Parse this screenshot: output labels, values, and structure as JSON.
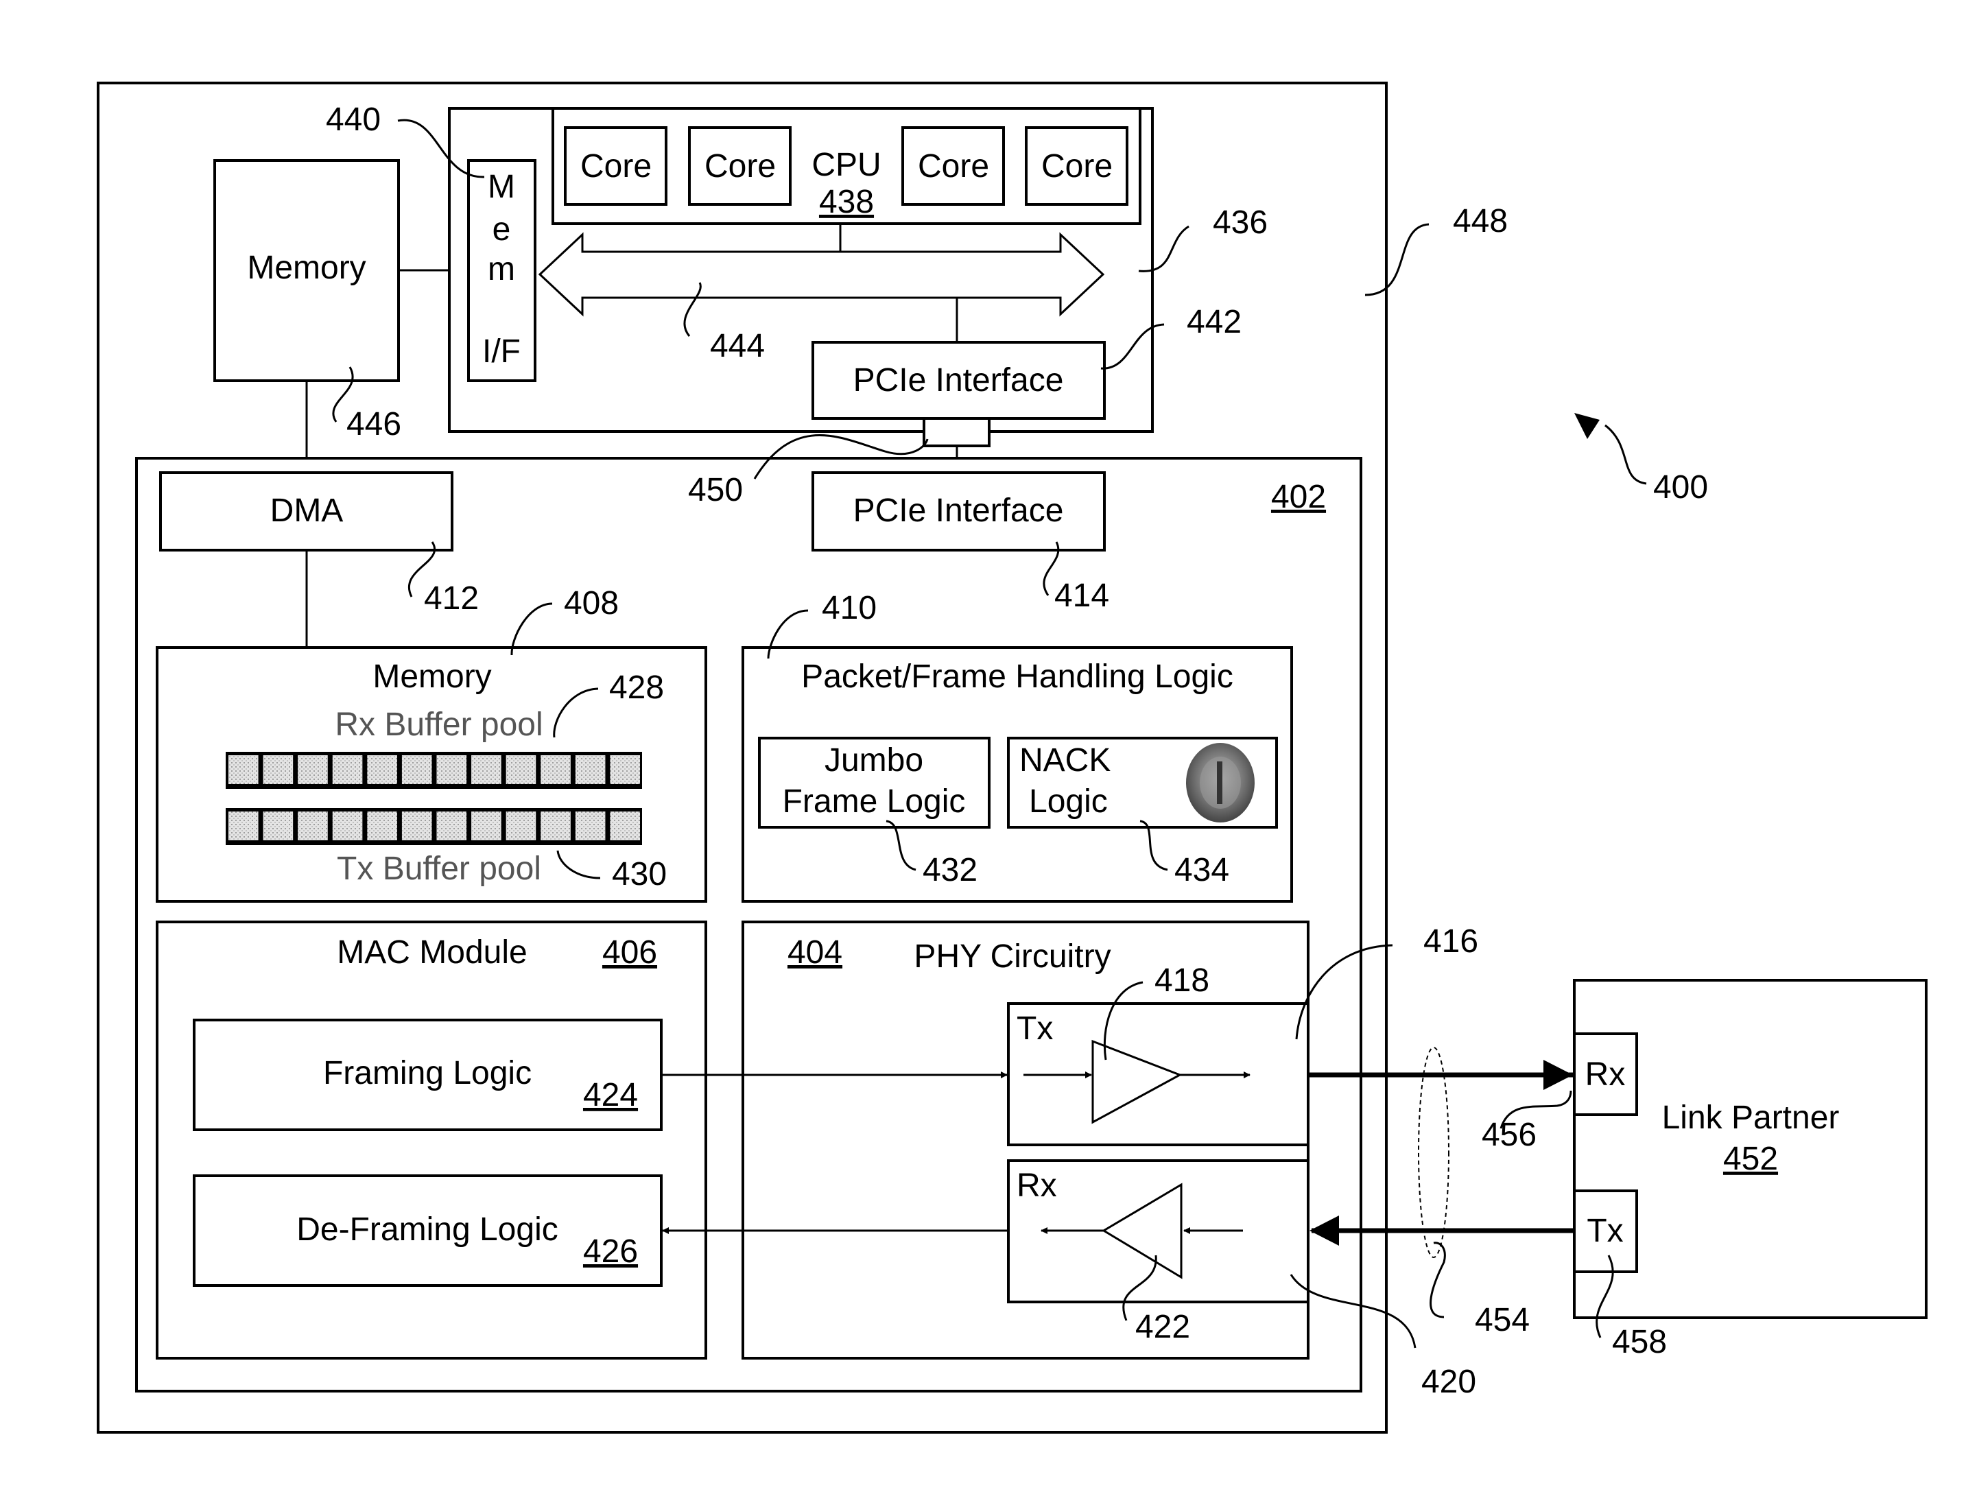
{
  "figure": {
    "ref": "400",
    "system_ref": "448",
    "host": {
      "ref": "436",
      "cpu_label": "CPU",
      "cpu_ref": "438",
      "cores": [
        "Core",
        "Core",
        "Core",
        "Core"
      ],
      "mem_if_label": [
        "M",
        "e",
        "m",
        "I/F"
      ],
      "mem_if_ref": "440",
      "bus_ref": "444",
      "pcie_label": "PCIe Interface",
      "pcie_ref": "442",
      "link_ref": "450"
    },
    "host_memory": {
      "label": "Memory",
      "ref": "446"
    },
    "nic": {
      "ref": "402",
      "dma": {
        "label": "DMA",
        "ref": "412"
      },
      "pcie": {
        "label": "PCIe Interface",
        "ref": "414"
      },
      "memory": {
        "label": "Memory",
        "ref": "408",
        "rx_pool_label": "Rx Buffer pool",
        "rx_pool_ref": "428",
        "tx_pool_label": "Tx Buffer pool",
        "tx_pool_ref": "430",
        "cells_per_pool": 12
      },
      "packet_logic": {
        "label": "Packet/Frame Handling Logic",
        "ref": "410",
        "jumbo_lines": [
          "Jumbo",
          "Frame Logic"
        ],
        "jumbo_ref": "432",
        "nack_lines": [
          "NACK",
          "Logic"
        ],
        "nack_ref": "434"
      },
      "mac": {
        "label": "MAC Module",
        "ref": "406",
        "framing_label": "Framing Logic",
        "framing_ref": "424",
        "deframing_label": "De-Framing Logic",
        "deframing_ref": "426"
      },
      "phy": {
        "label": "PHY Circuitry",
        "ref": "404",
        "tx_label": "Tx",
        "tx_ref": "416",
        "tx_amp_ref": "418",
        "rx_label": "Rx",
        "rx_ref": "420",
        "rx_amp_ref": "422"
      }
    },
    "link": {
      "ref": "454"
    },
    "link_partner": {
      "label": "Link Partner",
      "ref": "452",
      "rx_label": "Rx",
      "rx_ref": "456",
      "tx_label": "Tx",
      "tx_ref": "458"
    }
  }
}
